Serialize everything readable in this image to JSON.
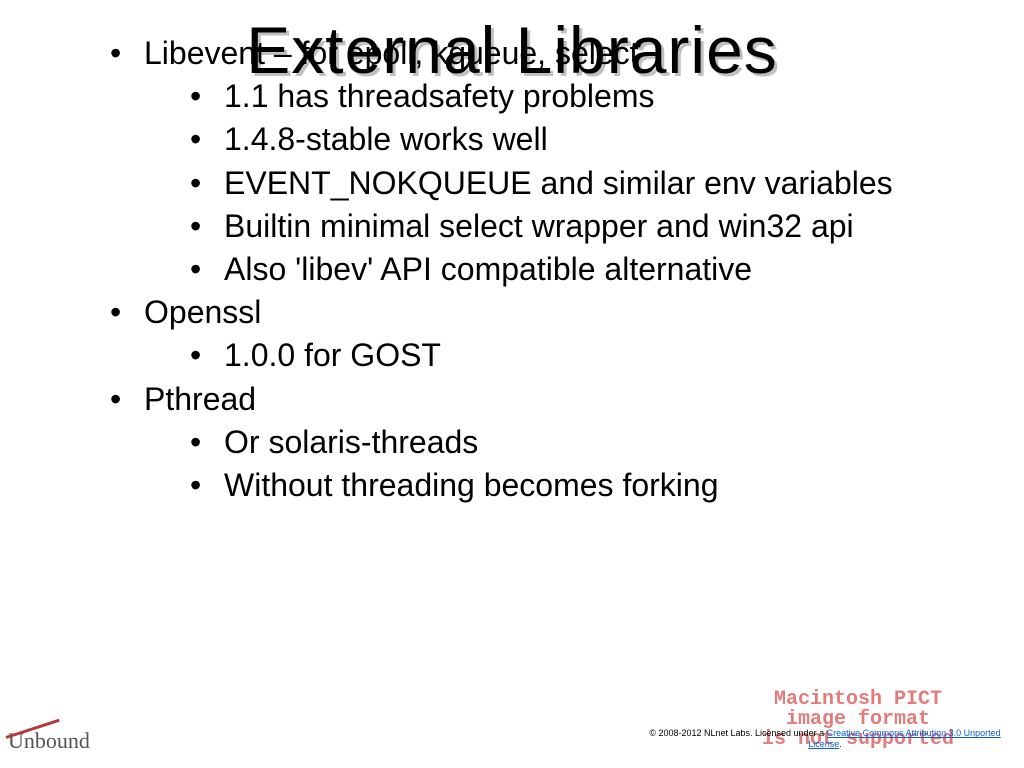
{
  "title": "External Libraries",
  "bullets": {
    "libevent": "Libevent – for epoll, kqueue, select",
    "libevent_sub": {
      "a": "1.1 has threadsafety problems",
      "b": "1.4.8-stable works well"
    },
    "event_nokqueue": "EVENT_NOKQUEUE and similar env variables",
    "builtin": "Builtin minimal select wrapper and win32 api",
    "libev": "Also 'libev' API compatible alternative",
    "openssl": "Openssl",
    "openssl_sub": {
      "a": "1.0.0 for GOST"
    },
    "pthread": "Pthread",
    "pthread_sub": {
      "a": "Or solaris-threads",
      "b": "Without threading becomes forking"
    }
  },
  "logo": "Unbound",
  "pict_placeholder": "Macintosh PICT\nimage format\nis not supported",
  "license": {
    "prefix": "© 2008-2012 NLnet Labs. Licensed under a ",
    "link_text": "Creative Commons Attribution 3.0 Unported License",
    "suffix": "."
  }
}
